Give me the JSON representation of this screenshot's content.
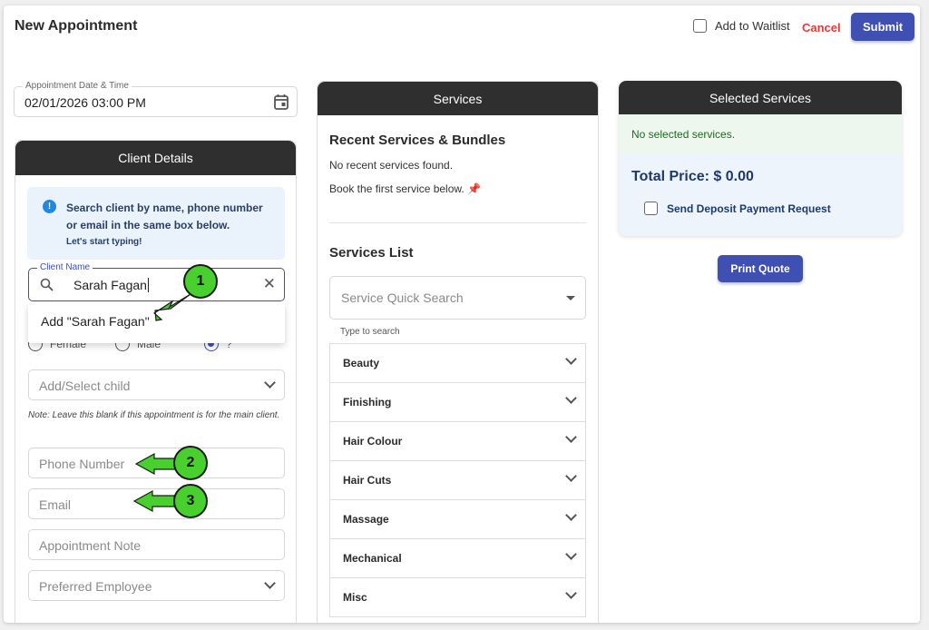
{
  "header": {
    "title": "New Appointment",
    "waitlist_label": "Add to Waitlist",
    "cancel_label": "Cancel",
    "submit_label": "Submit"
  },
  "appointment": {
    "label": "Appointment Date & Time",
    "value": "02/01/2026 03:00 PM"
  },
  "client_panel": {
    "title": "Client Details",
    "info_line": "Search client by name, phone number or email in the same box below.",
    "info_sub": "Let's start typing!",
    "client_name_label": "Client Name",
    "client_name_value": "Sarah Fagan",
    "dropdown_option": "Add \"Sarah Fagan\"",
    "gender_female": "Female",
    "gender_male": "Male",
    "gender_unknown": "?",
    "child_placeholder": "Add/Select child",
    "child_note": "Note: Leave this blank if this appointment is for the main client.",
    "phone_placeholder": "Phone Number",
    "email_placeholder": "Email",
    "note_placeholder": "Appointment Note",
    "employee_placeholder": "Preferred Employee"
  },
  "services_panel": {
    "title": "Services",
    "recent_heading": "Recent Services & Bundles",
    "recent_empty": "No recent services found.",
    "recent_hint": "Book the first service below. 📌",
    "list_heading": "Services List",
    "quick_search_placeholder": "Service Quick Search",
    "type_hint": "Type to search",
    "categories": [
      "Beauty",
      "Finishing",
      "Hair Colour",
      "Hair Cuts",
      "Massage",
      "Mechanical",
      "Misc"
    ]
  },
  "selected_panel": {
    "title": "Selected Services",
    "empty_text": "No selected services.",
    "total_price": "Total Price: $ 0.00",
    "deposit_label": "Send Deposit Payment Request"
  },
  "print_quote_label": "Print Quote",
  "callouts": [
    "1",
    "2",
    "3"
  ],
  "colors": {
    "primary": "#3f4fb2",
    "cancel": "#e53935",
    "panel_header": "#2f2f2f",
    "callout": "#48d12e"
  }
}
